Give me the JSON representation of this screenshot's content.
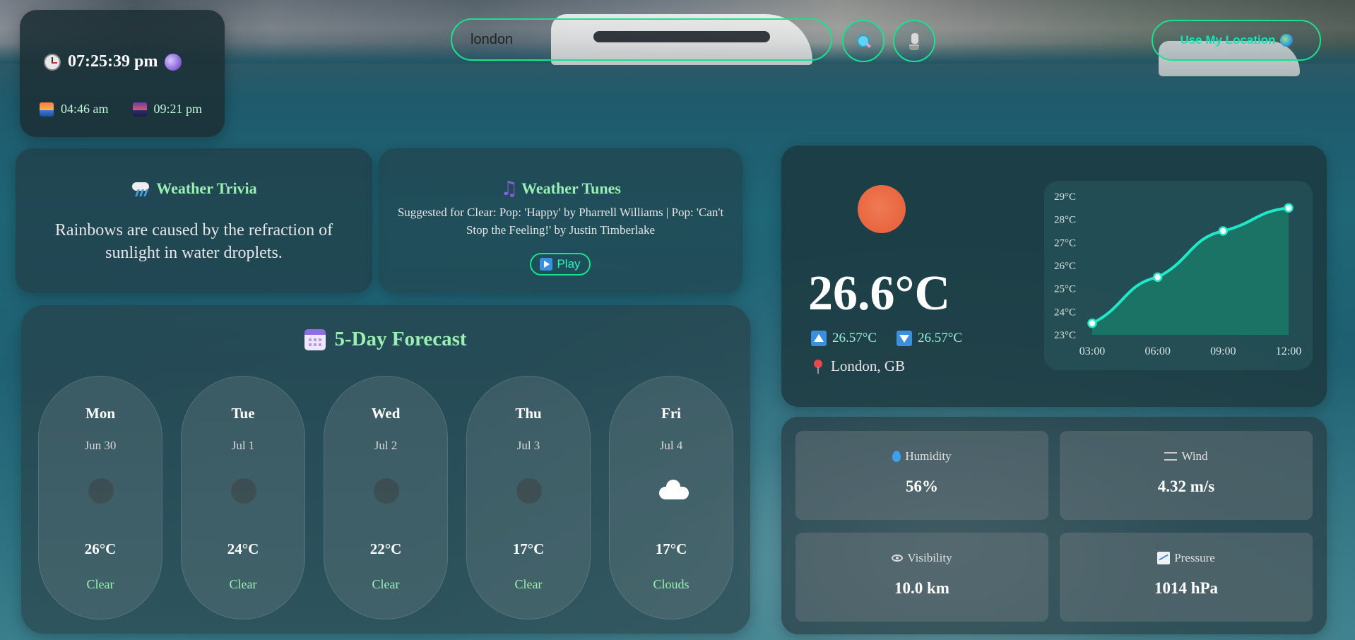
{
  "clock": {
    "time": "07:25:39 pm",
    "sunrise": "04:46 am",
    "sunset": "09:21 pm"
  },
  "search": {
    "value": "london",
    "placeholder": ""
  },
  "location_button": {
    "label": "Use My Location"
  },
  "trivia": {
    "title": "Weather Trivia",
    "text": "Rainbows are caused by the refraction of sunlight in water droplets."
  },
  "tunes": {
    "title": "Weather Tunes",
    "text": "Suggested for Clear: Pop: 'Happy' by Pharrell Williams | Pop: 'Can't Stop the Feeling!' by Justin Timberlake",
    "play_label": "Play"
  },
  "forecast": {
    "title": "5-Day Forecast",
    "days": [
      {
        "day": "Mon",
        "date": "Jun 30",
        "temp": "26°C",
        "cond": "Clear",
        "icon": "clear"
      },
      {
        "day": "Tue",
        "date": "Jul 1",
        "temp": "24°C",
        "cond": "Clear",
        "icon": "clear"
      },
      {
        "day": "Wed",
        "date": "Jul 2",
        "temp": "22°C",
        "cond": "Clear",
        "icon": "clear"
      },
      {
        "day": "Thu",
        "date": "Jul 3",
        "temp": "17°C",
        "cond": "Clear",
        "icon": "clear"
      },
      {
        "day": "Fri",
        "date": "Jul 4",
        "temp": "17°C",
        "cond": "Clouds",
        "icon": "clouds"
      }
    ]
  },
  "current": {
    "temp": "26.6°C",
    "max": "26.57°C",
    "min": "26.57°C",
    "location": "London, GB",
    "sun_color": "#e8653f"
  },
  "chart_data": {
    "type": "area",
    "x": [
      "03:00",
      "06:00",
      "09:00",
      "12:00"
    ],
    "series": [
      {
        "values": [
          23.5,
          25.5,
          27.5,
          28.5
        ]
      }
    ],
    "yticks": [
      "29°C",
      "28°C",
      "27°C",
      "26°C",
      "25°C",
      "24°C",
      "23°C"
    ],
    "ylim": [
      23,
      29
    ],
    "line_color": "#1de9c8",
    "fill_color": "#1a7a6a"
  },
  "stats": {
    "humidity": {
      "label": "Humidity",
      "value": "56%"
    },
    "wind": {
      "label": "Wind",
      "value": "4.32 m/s"
    },
    "visibility": {
      "label": "Visibility",
      "value": "10.0 km"
    },
    "pressure": {
      "label": "Pressure",
      "value": "1014 hPa"
    }
  },
  "colors": {
    "accent": "#19e28f",
    "title_green": "#9af0b4"
  }
}
